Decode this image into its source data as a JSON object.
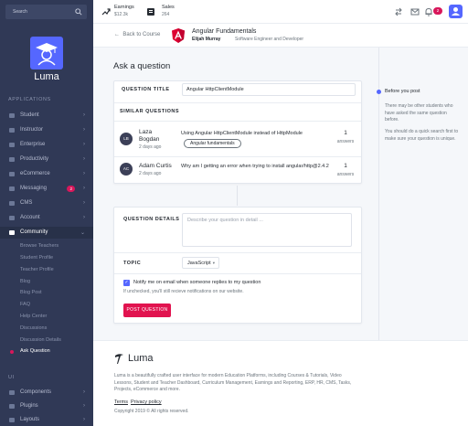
{
  "sidebar": {
    "search_placeholder": "Search",
    "brand": "Luma",
    "section_applications": "APPLICATIONS",
    "section_ui": "UI",
    "items": [
      {
        "label": "Student"
      },
      {
        "label": "Instructor"
      },
      {
        "label": "Enterprise"
      },
      {
        "label": "Productivity"
      },
      {
        "label": "eCommerce"
      },
      {
        "label": "Messaging",
        "badge": "2"
      },
      {
        "label": "CMS"
      },
      {
        "label": "Account"
      },
      {
        "label": "Community"
      }
    ],
    "community_sub": [
      "Browse Teachers",
      "Student Profile",
      "Teacher Profile",
      "Blog",
      "Blog Post",
      "FAQ",
      "Help Center",
      "Discussions",
      "Discussion Details",
      "Ask Question"
    ],
    "ui_items": [
      {
        "label": "Components"
      },
      {
        "label": "Plugins"
      },
      {
        "label": "Layouts"
      }
    ]
  },
  "topbar": {
    "earnings_label": "Earnings",
    "earnings_value": "$12.3k",
    "sales_label": "Sales",
    "sales_value": "264",
    "notification_count": "2"
  },
  "course_header": {
    "back_label": "Back to Course",
    "title": "Angular Fundamentals",
    "author": "Elijah Murray",
    "author_role": "Software Engineer and Developer"
  },
  "page": {
    "title": "Ask a question",
    "question_title_label": "QUESTION TITLE",
    "question_title_value": "Angular HttpClientModule",
    "similar_label": "SIMILAR QUESTIONS",
    "similar": [
      {
        "initials": "LB",
        "name_line1": "Laza",
        "name_line2": "Bogdan",
        "time": "2 days ago",
        "text": "Using Angular HttpClientModule instead of HttpModule",
        "tag": "Angular fundamentals",
        "answers": "1",
        "answers_label": "answers"
      },
      {
        "initials": "AC",
        "name_line1": "Adam Curtis",
        "time": "2 days ago",
        "text": "Why am I getting an error when trying to install angular/http@2.4.2",
        "answers": "1",
        "answers_label": "answers"
      }
    ],
    "details_label": "QUESTION DETAILS",
    "details_placeholder": "Describe your question in detail ...",
    "topic_label": "TOPIC",
    "topic_value": "JavaScript",
    "notify_label": "Notify me on email when someone replies to my question",
    "notify_hint": "If unchecked, you'll still recieve notifications on our website.",
    "post_button": "POST QUESTION"
  },
  "tips": {
    "title": "Before you post",
    "text1": "There may be other students who have asked the same question before.",
    "text2": "You should do a quick search first to make sure your question is unique."
  },
  "footer": {
    "brand": "Luma",
    "description": "Luma is a beautifully crafted user interface for modern Education Platforms, including Courses & Tutorials, Video Lessons, Student and Teacher Dashboard, Curriculum Management, Earnings and Reporting, ERP, HR, CMS, Tasks, Projects, eCommerce and more.",
    "terms": "Terms",
    "privacy": "Privacy policy",
    "copyright": "Copyright 2019 © All rights reserved."
  },
  "colors": {
    "sidebar_bg": "#303956",
    "accent": "#5567ff",
    "primary_button": "#e1134f",
    "badge": "#d8175b"
  }
}
